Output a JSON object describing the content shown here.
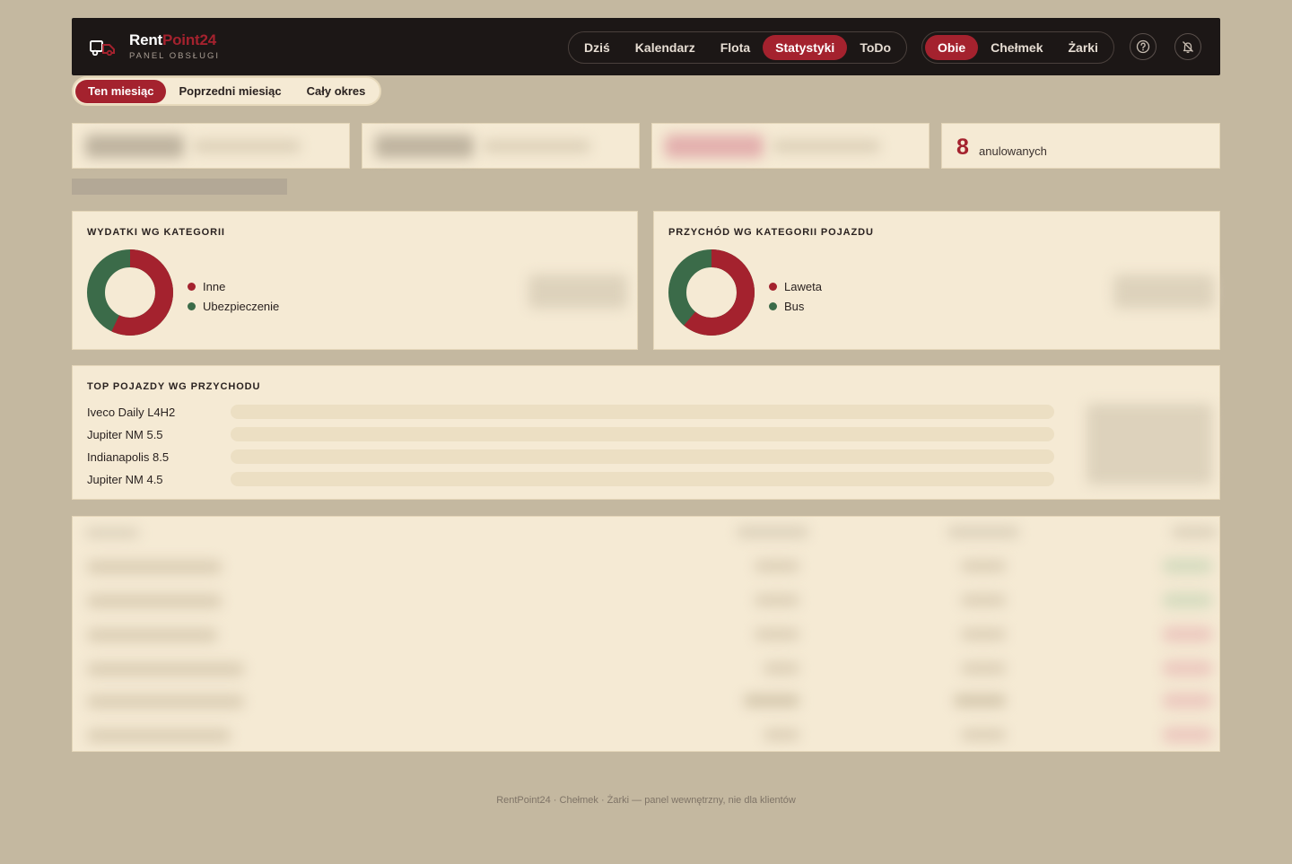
{
  "brand": {
    "name_part1": "Rent",
    "name_part2": "Point24",
    "subtitle": "PANEL OBSŁUGI"
  },
  "nav": {
    "main": [
      {
        "label": "Dziś",
        "active": false
      },
      {
        "label": "Kalendarz",
        "active": false
      },
      {
        "label": "Flota",
        "active": false
      },
      {
        "label": "Statystyki",
        "active": true
      },
      {
        "label": "ToDo",
        "active": false
      }
    ],
    "location": [
      {
        "label": "Obie",
        "active": true
      },
      {
        "label": "Chełmek",
        "active": false
      },
      {
        "label": "Żarki",
        "active": false
      }
    ],
    "icons": {
      "help": "help-circle-icon",
      "notifications": "bell-off-icon"
    }
  },
  "period_tabs": [
    {
      "label": "Ten miesiąc",
      "active": true
    },
    {
      "label": "Poprzedni miesiąc",
      "active": false
    },
    {
      "label": "Cały okres",
      "active": false
    }
  ],
  "stats": {
    "cancelled": {
      "value": "8",
      "label": "anulowanych"
    }
  },
  "expenses_by_category": {
    "title": "WYDATKI WG KATEGORII",
    "items": [
      {
        "label": "Inne",
        "color": "#a4222e",
        "share": 0.57
      },
      {
        "label": "Ubezpieczenie",
        "color": "#3b6b49",
        "share": 0.43
      }
    ]
  },
  "revenue_by_vehicle_category": {
    "title": "PRZYCHÓD WG KATEGORII POJAZDU",
    "items": [
      {
        "label": "Laweta",
        "color": "#a4222e",
        "share": 0.61
      },
      {
        "label": "Bus",
        "color": "#3b6b49",
        "share": 0.39
      }
    ]
  },
  "top_vehicles": {
    "title": "TOP POJAZDY WG PRZYCHODU",
    "rows": [
      {
        "name": "Iveco Daily L4H2"
      },
      {
        "name": "Jupiter NM 5.5"
      },
      {
        "name": "Indianapolis 8.5"
      },
      {
        "name": "Jupiter NM 4.5"
      }
    ]
  },
  "colors": {
    "accent": "#a4222e",
    "green": "#3b6b49",
    "card": "#f5ead4",
    "topbar": "#1c1716"
  },
  "footer": {
    "text": "RentPoint24 · Chełmek · Żarki — panel wewnętrzny, nie dla klientów"
  }
}
